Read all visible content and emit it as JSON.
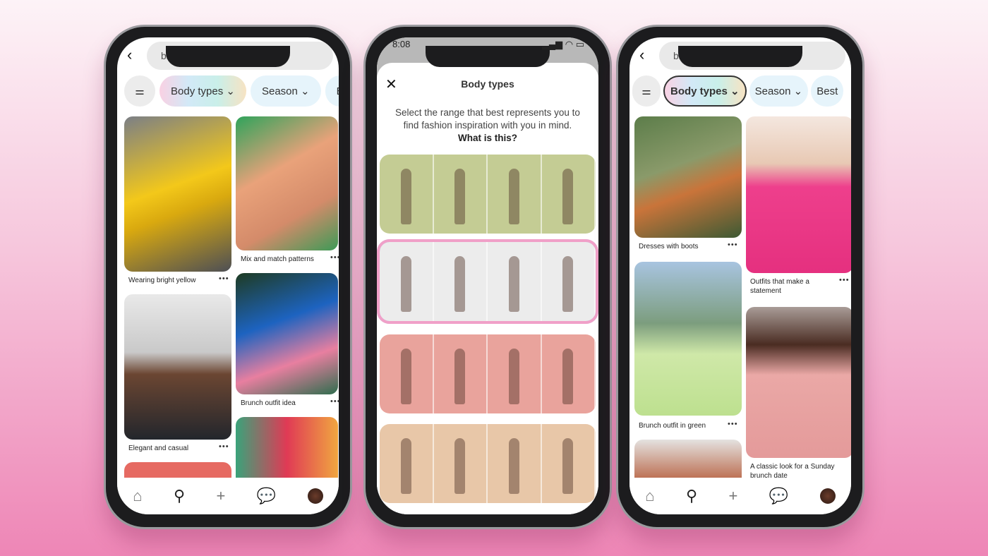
{
  "search": {
    "query": "brunch outfits"
  },
  "chips": {
    "filter_icon": "sliders-icon",
    "body_types": "Body types",
    "season": "Season",
    "best_left": "B",
    "best_right": "Best"
  },
  "left_pins": [
    {
      "caption": "Wearing bright yellow"
    },
    {
      "caption": "Mix and match patterns"
    },
    {
      "caption": "Elegant and casual"
    },
    {
      "caption": "Brunch outfit idea"
    }
  ],
  "right_pins": [
    {
      "caption": "Dresses with boots"
    },
    {
      "caption": "Outfits that make a statement"
    },
    {
      "caption": "Brunch outfit in green"
    },
    {
      "caption": "A classic look for a Sunday brunch date"
    }
  ],
  "modal": {
    "time": "8:08",
    "title": "Body types",
    "description": "Select the range that best represents you to find fashion inspiration with you in mind.",
    "link": "What is this?",
    "close_icon": "close-icon",
    "rows": [
      {
        "color": "#c4cc94"
      },
      {
        "color": "#ececec",
        "selected": true
      },
      {
        "color": "#e9a39c"
      },
      {
        "color": "#e8c7a8"
      }
    ]
  },
  "nav": {
    "icons": [
      "home-icon",
      "search-icon",
      "plus-icon",
      "chat-icon",
      "avatar"
    ]
  },
  "more": "•••"
}
